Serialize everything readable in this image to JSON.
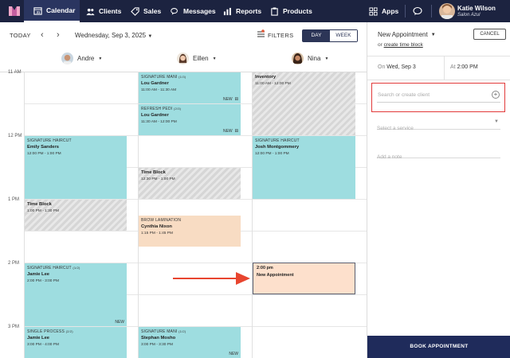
{
  "nav": {
    "items": [
      {
        "label": "Calendar",
        "icon": "calendar-icon",
        "active": true
      },
      {
        "label": "Clients",
        "icon": "people-icon"
      },
      {
        "label": "Sales",
        "icon": "tag-icon"
      },
      {
        "label": "Messages",
        "icon": "chat-bubbles-icon"
      },
      {
        "label": "Reports",
        "icon": "bar-chart-icon"
      },
      {
        "label": "Products",
        "icon": "product-box-icon"
      }
    ],
    "apps_label": "Apps",
    "user": {
      "name": "Katie Wilson",
      "business": "Salon Azul"
    }
  },
  "calendar": {
    "today_label": "TODAY",
    "date_label": "Wednesday, Sep 3, 2025",
    "filters_label": "FILTERS",
    "view": {
      "day": "DAY",
      "week": "WEEK",
      "selected": "DAY"
    },
    "staff": [
      "Andre",
      "Eillen",
      "Nina"
    ],
    "time_labels": [
      "11 AM",
      "12 PM",
      "1 PM",
      "2 PM",
      "3 PM"
    ],
    "appointments": [
      {
        "staff": "Eillen",
        "service": "SIGNATURE MANI",
        "duration": "(1/3)",
        "client": "Lou Gardner",
        "time": "11:00 AM - 11:30 AM",
        "badge": "NEW",
        "color": "teal"
      },
      {
        "staff": "Eillen",
        "service": "REFRESH PEDI",
        "duration": "(2/3)",
        "client": "Lou Gardner",
        "time": "11:30 AM - 12:00 PM",
        "badge": "NEW",
        "color": "teal"
      },
      {
        "staff": "Nina",
        "service": "",
        "client": "Inventory",
        "time": "11:00 AM - 12:00 PM",
        "color": "blocked"
      },
      {
        "staff": "Andre",
        "service": "SIGNATURE HAIRCUT",
        "client": "Emily Sanders",
        "time": "12:00 PM - 1:00 PM",
        "color": "teal"
      },
      {
        "staff": "Nina",
        "service": "SIGNATURE HAIRCUT",
        "client": "Josh Montgommery",
        "time": "12:00 PM - 1:00 PM",
        "color": "teal"
      },
      {
        "staff": "Eillen",
        "service": "",
        "client": "Time Block",
        "time": "12:30 PM - 1:00 PM",
        "color": "blocked"
      },
      {
        "staff": "Andre",
        "service": "",
        "client": "Time Block",
        "time": "1:00 PM - 1:30 PM",
        "color": "blocked"
      },
      {
        "staff": "Eillen",
        "service": "BROW LAMINATION",
        "client": "Cynthia Nixon",
        "time": "1:15 PM - 1:45 PM",
        "color": "peach"
      },
      {
        "staff": "Andre",
        "service": "SIGNATURE HAIRCUT",
        "duration": "(1/2)",
        "client": "Jamie Lee",
        "time": "2:00 PM - 3:00 PM",
        "badge": "NEW",
        "color": "teal"
      },
      {
        "staff": "Andre",
        "service": "SINGLE PROCESS",
        "duration": "(2/2)",
        "client": "Jamie Lee",
        "time": "3:00 PM - 4:00 PM",
        "color": "teal"
      },
      {
        "staff": "Eillen",
        "service": "SIGNATURE MANI",
        "duration": "(1/2)",
        "client": "Stephan Mosho",
        "time": "3:00 PM - 3:30 PM",
        "badge": "NEW",
        "color": "teal"
      }
    ],
    "new_appointment": {
      "time": "2:00 pm",
      "label": "New Appointment"
    }
  },
  "panel": {
    "title": "New Appointment",
    "or_text": "or",
    "create_block_link": "create time block",
    "cancel_label": "CANCEL",
    "on_label": "On",
    "on_value": "Wed, Sep 3",
    "at_label": "At",
    "at_value": "2:00 PM",
    "search_placeholder": "Search or create client",
    "service_placeholder": "Select a service",
    "note_placeholder": "Add a note",
    "book_label": "BOOK APPOINTMENT"
  },
  "colors": {
    "nav_bg": "#1c2340",
    "teal": "#9edde0",
    "peach": "#f8dcc3",
    "highlight_red": "#e23a3a",
    "book_button": "#1f2b5b"
  }
}
